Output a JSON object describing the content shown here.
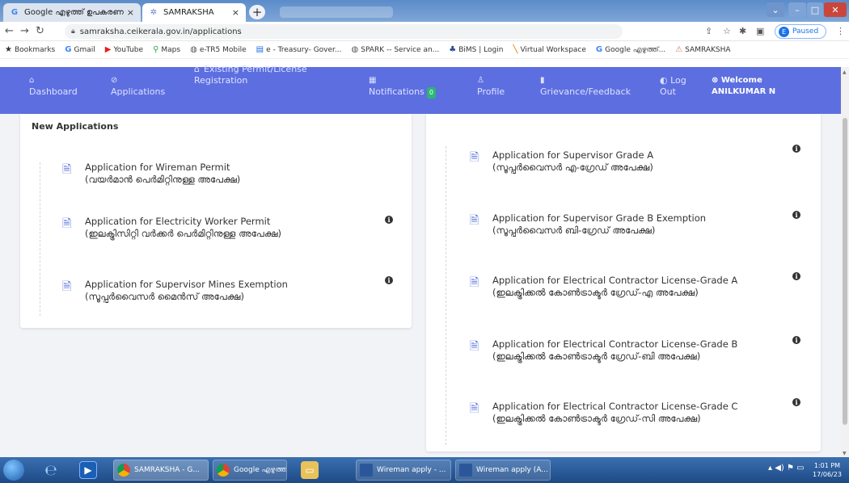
{
  "browser": {
    "tabs": [
      {
        "label": "Google എഴുത്ത് ഉപകരണ",
        "icon": "google-icon",
        "close": "×"
      },
      {
        "label": "SAMRAKSHA",
        "icon": "samraksha-icon",
        "close": "×"
      }
    ],
    "new_tab": "+",
    "url": "samraksha.ceikerala.gov.in/applications",
    "profile_initial": "E",
    "profile_status": "Paused"
  },
  "bookmarks": [
    {
      "label": "Bookmarks",
      "icon": "star-icon"
    },
    {
      "label": "Gmail",
      "icon": "google-icon"
    },
    {
      "label": "YouTube",
      "icon": "youtube-icon"
    },
    {
      "label": "Maps",
      "icon": "maps-icon"
    },
    {
      "label": "e-TR5 Mobile",
      "icon": "globe-icon"
    },
    {
      "label": "e - Treasury- Gover...",
      "icon": "treasury-icon"
    },
    {
      "label": "SPARK -- Service an...",
      "icon": "globe-icon"
    },
    {
      "label": "BiMS | Login",
      "icon": "bims-icon"
    },
    {
      "label": "Virtual Workspace",
      "icon": "workspace-icon"
    },
    {
      "label": "Google എഴുത്ത്...",
      "icon": "google-icon"
    },
    {
      "label": "SAMRAKSHA",
      "icon": "samraksha-icon"
    }
  ],
  "nav": {
    "dashboard": "Dashboard",
    "applications": "Applications",
    "existing_1": "Existing Permit/License",
    "existing_2": "Registration",
    "notifications": "Notifications",
    "notifications_count": "0",
    "profile": "Profile",
    "grievance": "Grievance/Feedback",
    "log_1": "Log",
    "log_2": "Out",
    "welcome": "Welcome",
    "user": "ANILKUMAR N"
  },
  "left_card": {
    "title": "New Applications",
    "items": [
      {
        "en": "Application for Wireman Permit",
        "ml": "(വയർമാൻ പെർമിറ്റിനുള്ള അപേക്ഷ)"
      },
      {
        "en": "Application for Electricity Worker Permit",
        "ml": "(ഇലക്ട്രിസിറ്റി വർക്കർ പെർമിറ്റിനുള്ള അപേക്ഷ)"
      },
      {
        "en": "Application for Supervisor Mines Exemption",
        "ml": "(സൂപ്പർവൈസർ മൈൻസ് അപേക്ഷ)"
      }
    ]
  },
  "right_card": {
    "items": [
      {
        "en": "Application for Supervisor Grade A",
        "ml": "(സൂപ്പർവൈസർ എ-ഗ്രേഡ് അപേക്ഷ)"
      },
      {
        "en": "Application for Supervisor Grade B Exemption",
        "ml": "(സൂപ്പർവൈസർ ബി-ഗ്രേഡ് അപേക്ഷ)"
      },
      {
        "en": "Application for Electrical Contractor License-Grade A",
        "ml": "(ഇലക്ട്രിക്കൽ കോൺട്രാക്ടർ ഗ്രേഡ്-എ അപേക്ഷ)"
      },
      {
        "en": "Application for Electrical Contractor License-Grade B",
        "ml": "(ഇലക്ട്രിക്കൽ കോൺട്രാക്ടർ ഗ്രേഡ്-ബി അപേക്ഷ)"
      },
      {
        "en": "Application for Electrical Contractor License-Grade C",
        "ml": "(ഇലക്ട്രിക്കൽ കോൺട്രാക്ടർ ഗ്രേഡ്-സി അപേക്ഷ)"
      }
    ]
  },
  "info_glyph": "i",
  "taskbar": {
    "tasks": [
      "SAMRAKSHA - G...",
      "Google എഴുത്ത് ...",
      "Wireman apply - ...",
      "Wireman apply (A..."
    ],
    "time": "1:01 PM",
    "date": "17/06/23"
  },
  "colors": {
    "nav_bg": "#5d6fe0",
    "accent": "#4f6bd8",
    "badge": "#2bb673"
  }
}
